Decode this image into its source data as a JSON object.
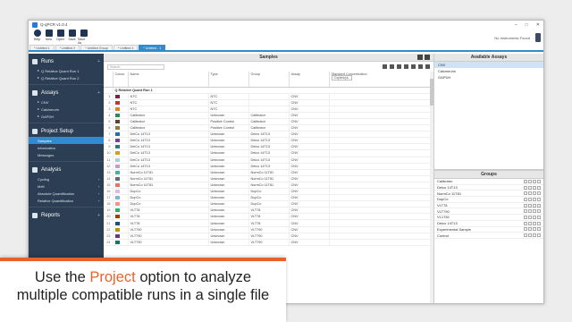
{
  "window": {
    "title": "Q-qPCR v1.0.4"
  },
  "toolbar": {
    "buttons": [
      {
        "label": "Help",
        "icon": "help-icon"
      },
      {
        "label": "New",
        "icon": "new-file-icon"
      },
      {
        "label": "Open",
        "icon": "open-folder-icon"
      },
      {
        "label": "Save",
        "icon": "save-icon"
      },
      {
        "label": "Save As",
        "icon": "save-as-icon"
      }
    ],
    "status": "No Instruments Found"
  },
  "tabs": [
    "* Untitled 1",
    "* Untitled 2",
    "* Untitled Group",
    "* Untitled 3",
    "* Untitled - 1"
  ],
  "sidebar": {
    "runs_label": "Runs",
    "runs": [
      "Q Relative Quant Run 1",
      "Q Relative Quant Run 2"
    ],
    "assays_label": "Assays",
    "assays": [
      "CNV",
      "Calcineurin",
      "GAPDH"
    ],
    "project_label": "Project Setup",
    "project_items": [
      "Samples",
      "Information",
      "Messages"
    ],
    "analysis_label": "Analysis",
    "analysis_items": [
      "Cycling",
      "Melt",
      "Absolute Quantification",
      "Relative Quantification"
    ],
    "reports_label": "Reports"
  },
  "samples": {
    "title": "Samples",
    "search_placeholder": "Search",
    "columns": [
      "Colour",
      "Name",
      "Type",
      "Group",
      "Assay",
      "Standard Concentration"
    ],
    "conc_unit": "Copies/µL",
    "group_row": "Q Relative Quant Run 1",
    "rows": [
      {
        "n": "1",
        "color": "#8b1a4a",
        "name": "NTC",
        "type": "NTC",
        "group": "",
        "assay": "CNV"
      },
      {
        "n": "2",
        "color": "#c0392b",
        "name": "NTC",
        "type": "NTC",
        "group": "",
        "assay": "CNV"
      },
      {
        "n": "3",
        "color": "#e67e22",
        "name": "NTC",
        "type": "NTC",
        "group": "",
        "assay": "CNV"
      },
      {
        "n": "4",
        "color": "#2e8b57",
        "name": "Calibrator",
        "type": "Unknown",
        "group": "Calibrator",
        "assay": "CNV"
      },
      {
        "n": "5",
        "color": "#5a4632",
        "name": "Calibrator",
        "type": "Positive Control",
        "group": "Calibrator",
        "assay": "CNV"
      },
      {
        "n": "6",
        "color": "#8e7c3a",
        "name": "Calibrator",
        "type": "Positive Control",
        "group": "Calibrator",
        "assay": "CNV"
      },
      {
        "n": "7",
        "color": "#1f6fb2",
        "name": "DelCo 14T13",
        "type": "Unknown",
        "group": "Delco 14T13",
        "assay": "CNV"
      },
      {
        "n": "8",
        "color": "#7d3c98",
        "name": "DelCo 14T13",
        "type": "Unknown",
        "group": "Delco 14T13",
        "assay": "CNV"
      },
      {
        "n": "9",
        "color": "#2c7a7b",
        "name": "DelCo 14T13",
        "type": "Unknown",
        "group": "Delco 14T13",
        "assay": "CNV"
      },
      {
        "n": "10",
        "color": "#d4a017",
        "name": "DelCo 14T13",
        "type": "Unknown",
        "group": "Delco 14T13",
        "assay": "CNV"
      },
      {
        "n": "11",
        "color": "#a9cce3",
        "name": "DelCo 14T13",
        "type": "Unknown",
        "group": "Delco 14T13",
        "assay": "CNV"
      },
      {
        "n": "12",
        "color": "#c39bd3",
        "name": "DelCo 14T13",
        "type": "Unknown",
        "group": "Delco 14T13",
        "assay": "CNV"
      },
      {
        "n": "13",
        "color": "#45b39d",
        "name": "NormCo 11T81",
        "type": "Unknown",
        "group": "NormCo 11T81",
        "assay": "CNV"
      },
      {
        "n": "14",
        "color": "#5d6d7e",
        "name": "NormCo 11T81",
        "type": "Unknown",
        "group": "NormCo 11T81",
        "assay": "CNV"
      },
      {
        "n": "15",
        "color": "#ec7063",
        "name": "NormCo 11T81",
        "type": "Unknown",
        "group": "NormCo 11T81",
        "assay": "CNV"
      },
      {
        "n": "16",
        "color": "#d7bde2",
        "name": "DupCo",
        "type": "Unknown",
        "group": "DupCo",
        "assay": "CNV"
      },
      {
        "n": "17",
        "color": "#7fb3d5",
        "name": "DupCo",
        "type": "Unknown",
        "group": "DupCo",
        "assay": "CNV"
      },
      {
        "n": "18",
        "color": "#f1948a",
        "name": "DupCo",
        "type": "Unknown",
        "group": "DupCo",
        "assay": "CNV"
      },
      {
        "n": "19",
        "color": "#28b463",
        "name": "VLT78",
        "type": "Unknown",
        "group": "VLT78",
        "assay": "CNV"
      },
      {
        "n": "20",
        "color": "#a04000",
        "name": "VLT78",
        "type": "Unknown",
        "group": "VLT78",
        "assay": "CNV"
      },
      {
        "n": "21",
        "color": "#1a5276",
        "name": "VLT78",
        "type": "Unknown",
        "group": "VLT78",
        "assay": "CNV"
      },
      {
        "n": "22",
        "color": "#b7950b",
        "name": "VLT790",
        "type": "Unknown",
        "group": "VLT790",
        "assay": "CNV"
      },
      {
        "n": "23",
        "color": "#6c3483",
        "name": "VLT790",
        "type": "Unknown",
        "group": "VLT790",
        "assay": "CNV"
      },
      {
        "n": "24",
        "color": "#117864",
        "name": "VLT790",
        "type": "Unknown",
        "group": "VLT790",
        "assay": "CNV"
      }
    ]
  },
  "available_assays": {
    "title": "Available Assays",
    "items": [
      "CNV",
      "Calcineurin",
      "GAPDH"
    ]
  },
  "groups": {
    "title": "Groups",
    "items": [
      "Calibrator",
      "Delco 14T13",
      "NormCo 11T81",
      "DupCo",
      "VLT78",
      "VLT790",
      "VL1T81",
      "Delco 14T13",
      "Experimental Sample",
      "Control"
    ]
  },
  "banner": {
    "line1_a": "Use the ",
    "line1_hl": "Project",
    "line1_b": " option to analyze",
    "line2": "multiple compatible runs in a single file"
  },
  "colors": {
    "accent": "#2f8ccf",
    "sidebar": "#2c3e53",
    "highlight": "#e8632b"
  }
}
